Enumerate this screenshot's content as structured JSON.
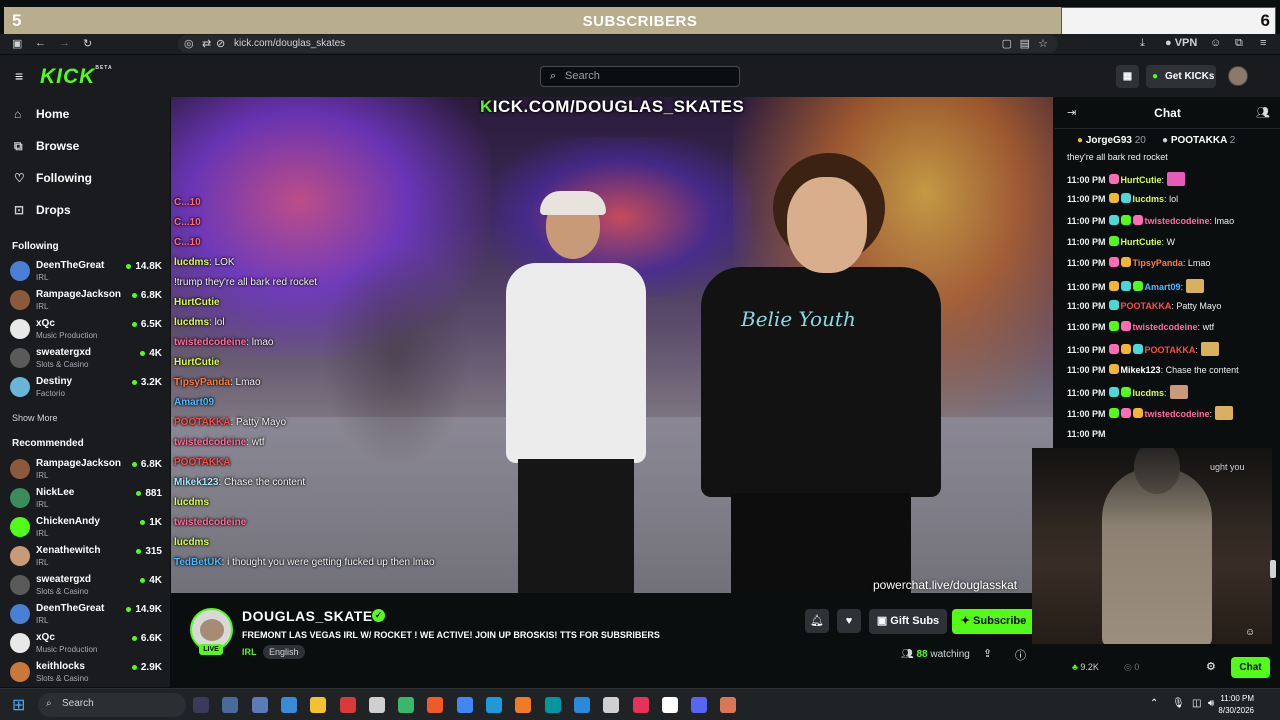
{
  "overlay": {
    "left_count": "5",
    "title": "SUBSCRIBERS",
    "right_count": "6"
  },
  "browser": {
    "url": "kick.com/douglas_skates",
    "vpn": "VPN"
  },
  "header": {
    "search_placeholder": "Search",
    "get_kicks": "Get KICKs",
    "logo": "KICK",
    "logo_beta": "BETA"
  },
  "sidebar": {
    "nav": [
      {
        "label": "Home",
        "icon": "home-icon"
      },
      {
        "label": "Browse",
        "icon": "browse-icon"
      },
      {
        "label": "Following",
        "icon": "heart-icon"
      },
      {
        "label": "Drops",
        "icon": "gift-icon"
      }
    ],
    "following_title": "Following",
    "following": [
      {
        "name": "DeenTheGreat",
        "cat": "IRL",
        "viewers": "14.8K",
        "color": "#4a7fd4"
      },
      {
        "name": "RampageJackson",
        "cat": "IRL",
        "viewers": "6.8K",
        "color": "#8b5a3c"
      },
      {
        "name": "xQc",
        "cat": "Music Production",
        "viewers": "6.5K",
        "color": "#e8e8e8"
      },
      {
        "name": "sweatergxd",
        "cat": "Slots & Casino",
        "viewers": "4K",
        "color": "#5a5a5a"
      },
      {
        "name": "Destiny",
        "cat": "Factorio",
        "viewers": "3.2K",
        "color": "#6ab4d8"
      }
    ],
    "show_more": "Show More",
    "recommended_title": "Recommended",
    "recommended": [
      {
        "name": "RampageJackson",
        "cat": "IRL",
        "viewers": "6.8K",
        "color": "#8b5a3c"
      },
      {
        "name": "NickLee",
        "cat": "IRL",
        "viewers": "881",
        "color": "#3c8b5a"
      },
      {
        "name": "ChickenAndy",
        "cat": "IRL",
        "viewers": "1K",
        "color": "#53fc18"
      },
      {
        "name": "Xenathewitch",
        "cat": "IRL",
        "viewers": "315",
        "color": "#c89a78"
      },
      {
        "name": "sweatergxd",
        "cat": "Slots & Casino",
        "viewers": "4K",
        "color": "#5a5a5a"
      },
      {
        "name": "DeenTheGreat",
        "cat": "IRL",
        "viewers": "14.9K",
        "color": "#4a7fd4"
      },
      {
        "name": "xQc",
        "cat": "Music Production",
        "viewers": "6.6K",
        "color": "#e8e8e8"
      },
      {
        "name": "keithlocks",
        "cat": "Slots & Casino",
        "viewers": "2.9K",
        "color": "#c8783c"
      }
    ]
  },
  "video": {
    "url_prefix": "K",
    "url_rest": "ICK.COM/DOUGLAS_SKATES",
    "powerchat": "powerchat.live/douglasskat",
    "shirt_text": "Belie Youth",
    "overlay_chat": [
      {
        "user": "C...10",
        "text": "",
        "color": "#ff6b6b"
      },
      {
        "user": "C...10",
        "text": "",
        "color": "#ff6b6b"
      },
      {
        "user": "C...10",
        "text": "",
        "color": "#ff6b6b"
      },
      {
        "user": "lucdms",
        "text": ": LOK",
        "color": "#d6ff3c"
      },
      {
        "user": "",
        "text": "!trump they're all bark red rocket",
        "color": "#4ab8ff"
      },
      {
        "user": "HurtCutie",
        "text": "",
        "color": "#d6ff3c"
      },
      {
        "user": "lucdms",
        "text": ": lol",
        "color": "#d6ff3c"
      },
      {
        "user": "twistedcodeine",
        "text": ": lmao",
        "color": "#ff6b9a"
      },
      {
        "user": "HurtCutie",
        "text": "",
        "color": "#d6ff3c"
      },
      {
        "user": "TipsyPanda",
        "text": ": Lmao",
        "color": "#ff7c3c"
      },
      {
        "user": "Amart09",
        "text": "",
        "color": "#4ab8ff"
      },
      {
        "user": "POOTAKKA",
        "text": ": Patty Mayo",
        "color": "#ff4a4a"
      },
      {
        "user": "twistedcodeine",
        "text": ": wtf",
        "color": "#ff6b9a"
      },
      {
        "user": "POOTAKKA",
        "text": "",
        "color": "#ff4a4a"
      },
      {
        "user": "Mikek123",
        "text": ": Chase the content",
        "color": "#a8e8ff"
      },
      {
        "user": "lucdms",
        "text": "",
        "color": "#d6ff3c"
      },
      {
        "user": "twistedcodeine",
        "text": "",
        "color": "#ff6b9a"
      },
      {
        "user": "lucdms",
        "text": "",
        "color": "#d6ff3c"
      },
      {
        "user": "TedBetUK",
        "text": ": i thought you were getting fucked up then lmao",
        "color": "#4ab8ff"
      }
    ]
  },
  "stream": {
    "channel": "DOUGLAS_SKATES",
    "title": "FREMONT LAS VEGAS IRL W/ ROCKET ! WE ACTIVE! JOIN UP BROSKIS! TTS FOR SUBSRIBERS",
    "category": "IRL",
    "language": "English",
    "live": "LIVE",
    "gift_subs": "Gift Subs",
    "subscribe": "Subscribe",
    "watching_count": "88",
    "watching_label": "watching"
  },
  "chat": {
    "title": "Chat",
    "gifters": [
      {
        "name": "JorgeG93",
        "count": "20"
      },
      {
        "name": "POOTAKKA",
        "count": "2"
      }
    ],
    "top_line": "they're all bark red rocket",
    "messages": [
      {
        "time": "11:00 PM",
        "user": "HurtCutie",
        "text": "",
        "color": "#d6ff3c"
      },
      {
        "time": "11:00 PM",
        "user": "lucdms",
        "text": " lol",
        "color": "#d6ff3c"
      },
      {
        "time": "11:00 PM",
        "user": "twistedcodeine",
        "text": " lmao",
        "color": "#ff6b9a"
      },
      {
        "time": "11:00 PM",
        "user": "HurtCutie",
        "text": " W",
        "color": "#d6ff3c"
      },
      {
        "time": "11:00 PM",
        "user": "TipsyPanda",
        "text": " Lmao",
        "color": "#ff7c3c"
      },
      {
        "time": "11:00 PM",
        "user": "Amart09",
        "text": "",
        "color": "#4ab8ff"
      },
      {
        "time": "11:00 PM",
        "user": "POOTAKKA",
        "text": " Patty Mayo",
        "color": "#ff4a4a"
      },
      {
        "time": "11:00 PM",
        "user": "twistedcodeine",
        "text": " wtf",
        "color": "#ff6b9a"
      },
      {
        "time": "11:00 PM",
        "user": "POOTAKKA",
        "text": "",
        "color": "#ff4a4a"
      },
      {
        "time": "11:00 PM",
        "user": "Mikek123",
        "text": " Chase the content",
        "color": "#ffffff"
      },
      {
        "time": "11:00 PM",
        "user": "lucdms",
        "text": "",
        "color": "#d6ff3c"
      },
      {
        "time": "11:00 PM",
        "user": "twistedcodeine",
        "text": "",
        "color": "#ff6b9a"
      },
      {
        "time": "11:00 PM",
        "user": "",
        "text": "",
        "color": "#ffffff"
      }
    ],
    "webcam_text": "ught you",
    "kicks_count": "9.2K",
    "zero": "0",
    "chat_button": "Chat"
  },
  "taskbar": {
    "search": "Search",
    "time": "11:00 PM",
    "date": "8/30/2026"
  },
  "colors": {
    "accent": "#53fc18",
    "bg": "#0b0e0f",
    "panel": "#191b1f"
  }
}
